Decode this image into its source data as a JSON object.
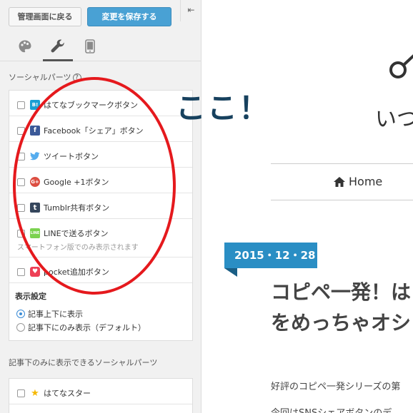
{
  "header": {
    "back_label": "管理画面に戻る",
    "save_label": "変更を保存する",
    "collapse_glyph": "⇤"
  },
  "tabs": [
    {
      "icon": "palette-icon",
      "active": false
    },
    {
      "icon": "wrench-icon",
      "active": true
    },
    {
      "icon": "mobile-icon",
      "active": false
    }
  ],
  "social_section": {
    "title": "ソーシャルパーツ",
    "help": "?",
    "items": [
      {
        "label": "はてなブックマークボタン",
        "icon": "hatena-bookmark-icon",
        "icon_text": "B!",
        "color": "#1a9fd4"
      },
      {
        "label": "Facebook「シェア」ボタン",
        "icon": "facebook-icon",
        "icon_text": "f",
        "color": "#3b5998"
      },
      {
        "label": "ツイートボタン",
        "icon": "twitter-icon",
        "icon_text": "",
        "color": "#55acee"
      },
      {
        "label": "Google +1ボタン",
        "icon": "google-plus-icon",
        "icon_text": "G+",
        "color": "#dc4e41"
      },
      {
        "label": "Tumblr共有ボタン",
        "icon": "tumblr-icon",
        "icon_text": "t",
        "color": "#35465c"
      },
      {
        "label": "LINEで送るボタン",
        "icon": "line-icon",
        "icon_text": "LINE",
        "color": "#7bd24f",
        "note": "スマートフォン版でのみ表示されます"
      },
      {
        "label": "pocket追加ボタン",
        "icon": "pocket-icon",
        "icon_text": "♥",
        "color": "#ee4056"
      }
    ],
    "display": {
      "title": "表示設定",
      "options": [
        {
          "label": "記事上下に表示",
          "selected": true
        },
        {
          "label": "記事下にのみ表示（デフォルト）",
          "selected": false
        }
      ]
    }
  },
  "bottom_section": {
    "title": "記事下のみに表示できるソーシャルパーツ",
    "items": [
      {
        "label": "はてなスター",
        "icon": "star-icon"
      }
    ]
  },
  "preview": {
    "site_subtitle": "いつ",
    "nav_home": "Home",
    "date": "2015・12・28",
    "title_line1": "コピペ一発！は",
    "title_line2": "をめっちゃオシ",
    "body_line1": "好評のコピペ一発シリーズの第",
    "body_line2": "今回はSNSシェアボタンのデ"
  },
  "annotation": {
    "text": "ここ！",
    "color": "#e5191d"
  }
}
